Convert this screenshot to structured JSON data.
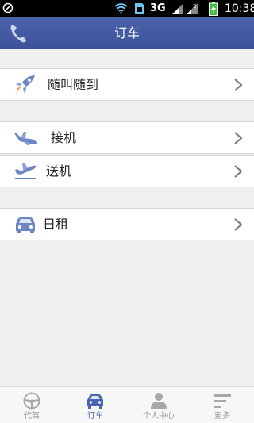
{
  "status_bar": {
    "network": "3G",
    "time": "10:38"
  },
  "header": {
    "title": "订车"
  },
  "menu": {
    "item1": {
      "label": "随叫随到",
      "icon": "rocket-icon"
    },
    "item2": {
      "label": "接机",
      "icon": "airplane-landing-icon"
    },
    "item3": {
      "label": "送机",
      "icon": "airplane-takeoff-icon"
    },
    "item4": {
      "label": "日租",
      "icon": "car-icon"
    }
  },
  "bottom_nav": {
    "tabs": [
      {
        "label": "代驾",
        "icon": "steering-wheel-icon",
        "active": false
      },
      {
        "label": "订车",
        "icon": "car-icon",
        "active": true
      },
      {
        "label": "个人中心",
        "icon": "person-icon",
        "active": false
      },
      {
        "label": "更多",
        "icon": "more-lines-icon",
        "active": false
      }
    ]
  },
  "colors": {
    "header": "#3f57a0",
    "accent": "#4a66b3",
    "icon_blue": "#6f86c6",
    "background": "#efefef"
  }
}
